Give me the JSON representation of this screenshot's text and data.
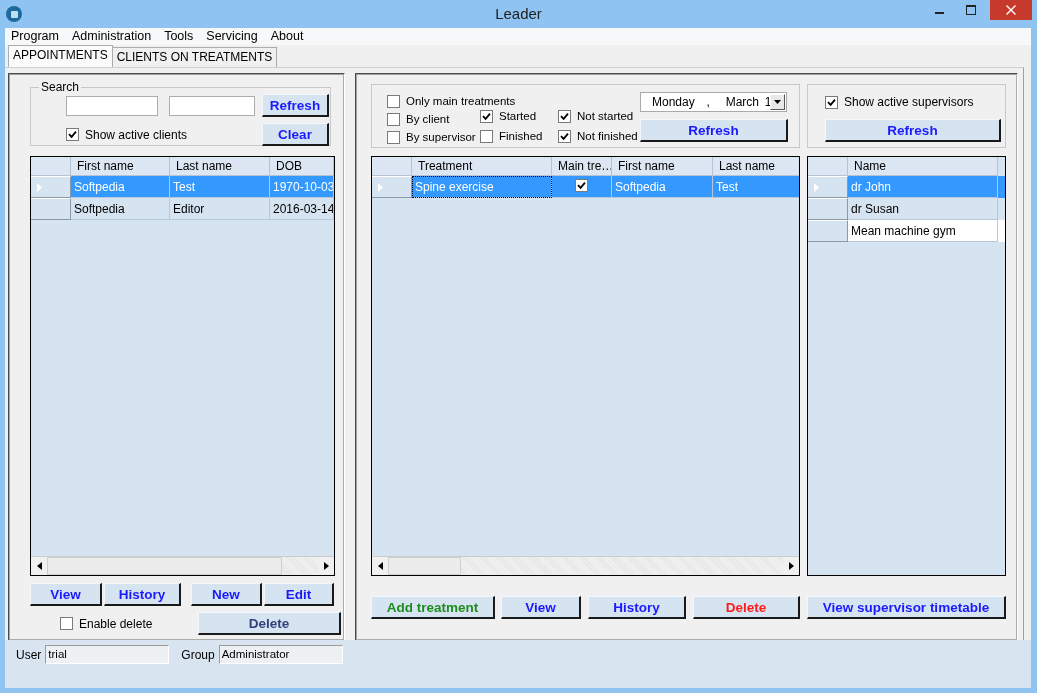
{
  "window": {
    "title": "Leader"
  },
  "menu": [
    "Program",
    "Administration",
    "Tools",
    "Servicing",
    "About"
  ],
  "tabs": [
    {
      "label": "APPOINTMENTS",
      "selected": true
    },
    {
      "label": "CLIENTS ON TREATMENTS",
      "selected": false
    }
  ],
  "clients": {
    "search_legend": "Search",
    "refresh_button": "Refresh",
    "clear_button": "Clear",
    "show_active": {
      "label": "Show active clients",
      "checked": true
    },
    "table": {
      "columns": [
        "First name",
        "Last name",
        "DOB"
      ],
      "rows": [
        {
          "selected": true,
          "cells": [
            "Softpedia",
            "Test",
            "1970-10-03"
          ]
        },
        {
          "selected": false,
          "cells": [
            "Softpedia",
            "Editor",
            "2016-03-14"
          ]
        }
      ]
    },
    "button_groups": [
      [
        "View",
        "History"
      ],
      [
        "New",
        "Edit"
      ]
    ],
    "enable_delete": {
      "label": "Enable delete",
      "checked": false
    },
    "delete_button": {
      "label": "Delete",
      "disabled": true
    }
  },
  "treatments": {
    "filter_columns": [
      [
        {
          "label": "Only main treatments",
          "checked": false
        },
        {
          "label": "By client",
          "checked": false
        },
        {
          "label": "By supervisor",
          "checked": false
        }
      ],
      [
        {
          "label": "Started",
          "checked": true
        },
        {
          "label": "Finished",
          "checked": false
        }
      ],
      [
        {
          "label": "Not started",
          "checked": true
        },
        {
          "label": "Not finished",
          "checked": true
        }
      ]
    ],
    "date": {
      "weekday": "Monday",
      "separator": ",",
      "month": "March",
      "day": "1"
    },
    "refresh_button": "Refresh",
    "table": {
      "columns": [
        "Treatment",
        "Main tre…",
        "First name",
        "Last name"
      ],
      "rows": [
        {
          "selected": true,
          "treatment": "Spine exercise",
          "main_treatment": true,
          "first_name": "Softpedia",
          "last_name": "Test"
        }
      ]
    }
  },
  "supervisors": {
    "show_active": {
      "label": "Show active supervisors",
      "checked": true
    },
    "refresh_button": "Refresh",
    "table": {
      "columns": [
        "Name"
      ],
      "rows": [
        {
          "selected": true,
          "name": "dr John"
        },
        {
          "selected": false,
          "name": "dr Susan"
        },
        {
          "selected": false,
          "name": "Mean machine gym"
        }
      ]
    }
  },
  "actions": [
    {
      "label": "Add treatment",
      "color": "#1e8c1e"
    },
    {
      "label": "View",
      "color": "#1a1aff"
    },
    {
      "label": "History",
      "color": "#1a1aff"
    },
    {
      "label": "Delete",
      "color": "#ff1a1a"
    },
    {
      "label": "View supervisor timetable",
      "color": "#1a1aff"
    }
  ],
  "status": {
    "user_label": "User",
    "user": "trial",
    "group_label": "Group",
    "group": "Administrator"
  }
}
